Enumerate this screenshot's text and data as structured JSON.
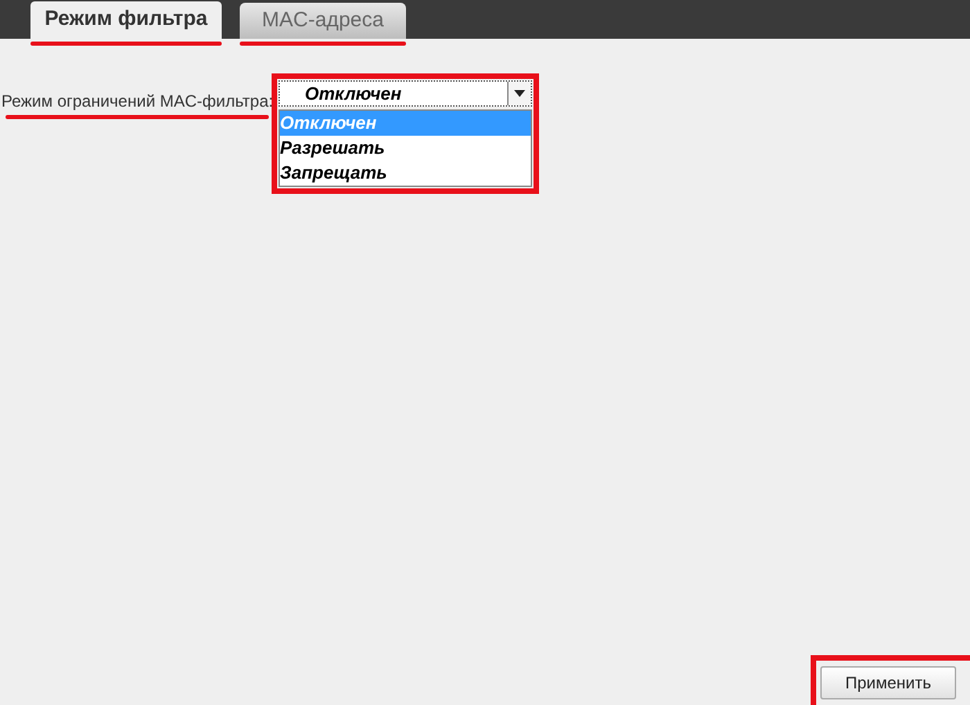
{
  "tabs": [
    {
      "label": "Режим фильтра",
      "selected": true
    },
    {
      "label": "MAC-адреса",
      "selected": false
    }
  ],
  "filter_mode": {
    "label": "Режим ограничений MAC-фильтра:",
    "value": "Отключен",
    "expanded": true,
    "options": [
      {
        "label": "Отключен",
        "selected": true
      },
      {
        "label": "Разрешать",
        "selected": false
      },
      {
        "label": "Запрещать",
        "selected": false
      }
    ]
  },
  "apply_button": "Применить"
}
